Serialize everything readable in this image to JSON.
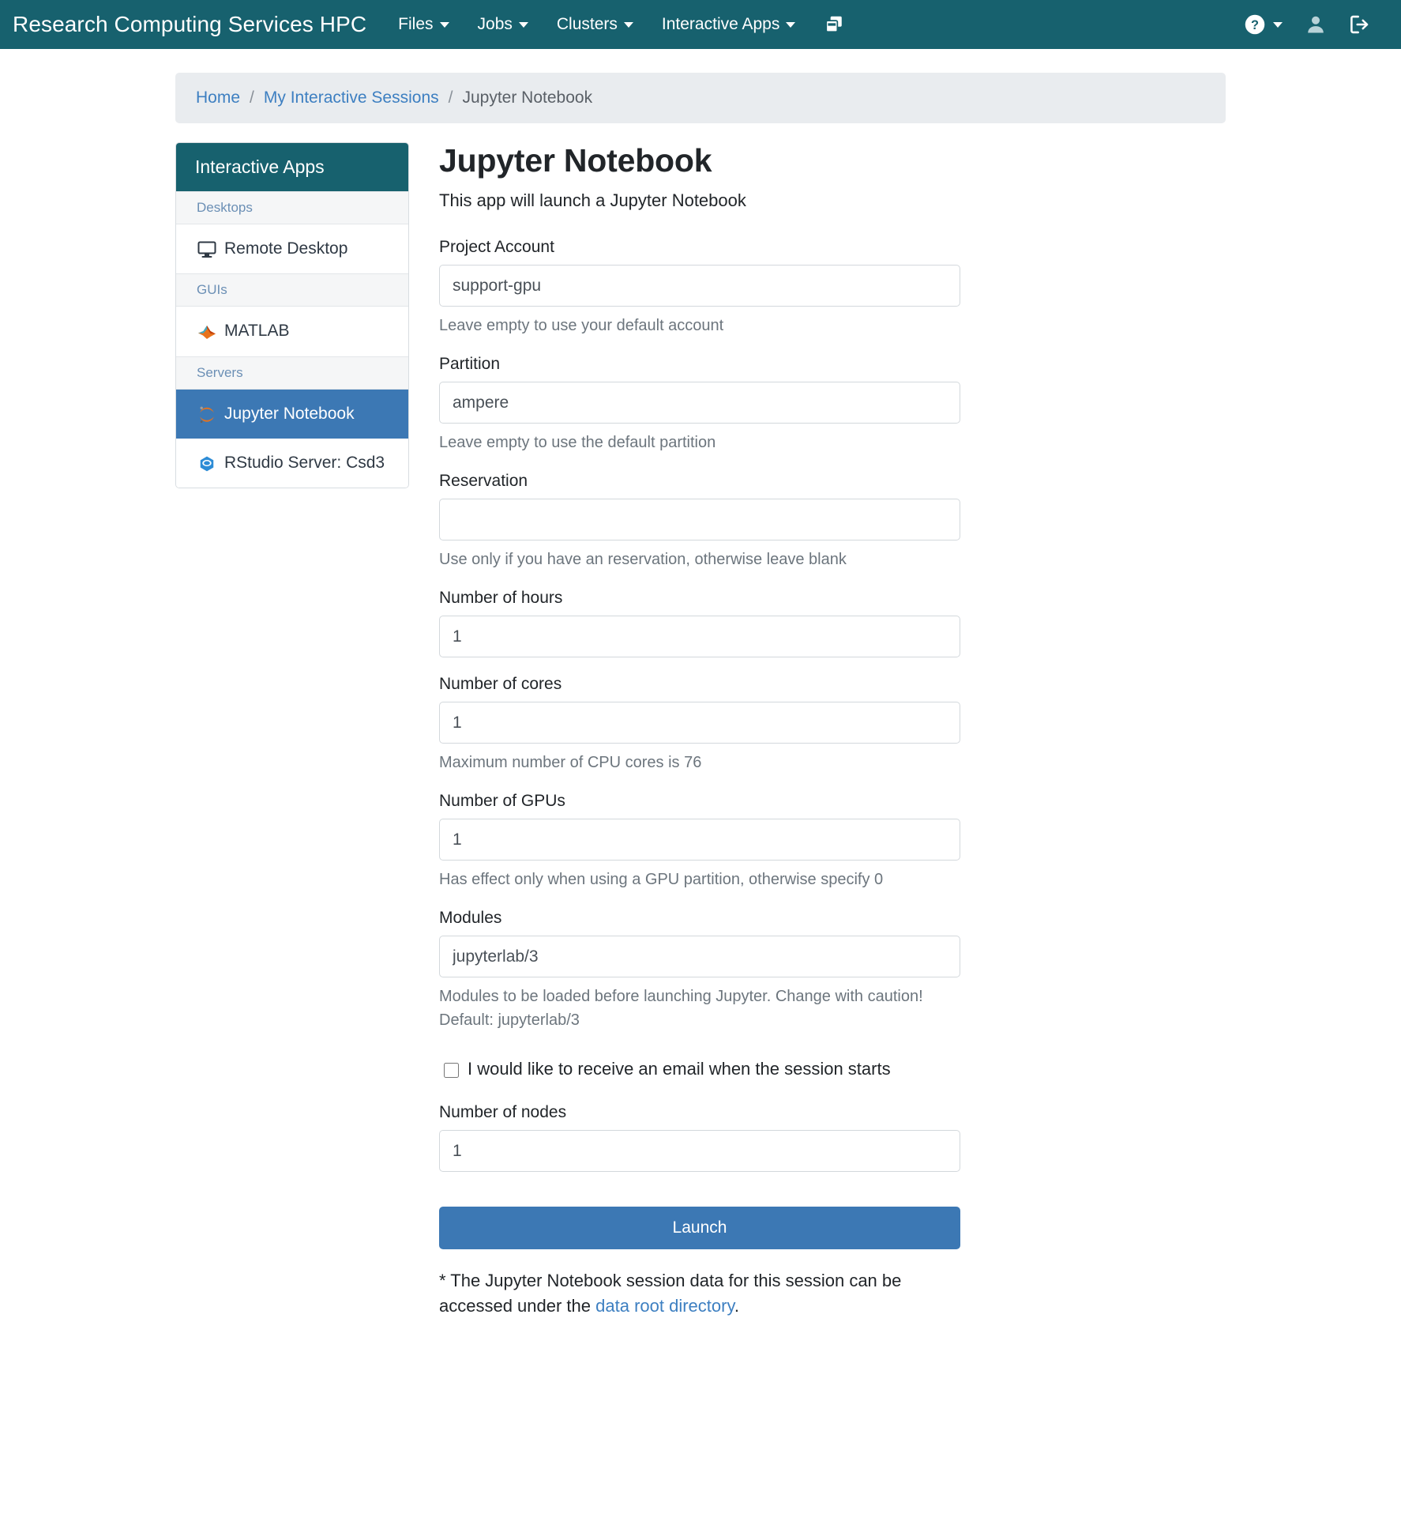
{
  "navbar": {
    "brand": "Research Computing Services HPC",
    "menus": [
      {
        "label": "Files",
        "icon": "chevron-down-icon"
      },
      {
        "label": "Jobs",
        "icon": "chevron-down-icon"
      },
      {
        "label": "Clusters",
        "icon": "chevron-down-icon"
      },
      {
        "label": "Interactive Apps",
        "icon": "chevron-down-icon"
      }
    ],
    "clone_icon": "windows-clone-icon",
    "help_icon": "question-circle-icon",
    "user_icon": "user-icon",
    "logout_icon": "sign-out-icon",
    "background": "#17616e"
  },
  "breadcrumb": {
    "items": [
      {
        "label": "Home",
        "link": true
      },
      {
        "label": "My Interactive Sessions",
        "link": true
      },
      {
        "label": "Jupyter Notebook",
        "link": false
      }
    ],
    "separator": "/"
  },
  "sidebar": {
    "header": "Interactive Apps",
    "groups": [
      {
        "label": "Desktops",
        "items": [
          {
            "label": "Remote Desktop",
            "icon": "desktop-icon",
            "active": false
          }
        ]
      },
      {
        "label": "GUIs",
        "items": [
          {
            "label": "MATLAB",
            "icon": "matlab-icon",
            "active": false
          }
        ]
      },
      {
        "label": "Servers",
        "items": [
          {
            "label": "Jupyter Notebook",
            "icon": "jupyter-icon",
            "active": true
          },
          {
            "label": "RStudio Server: Csd3",
            "icon": "rstudio-icon",
            "active": false
          }
        ]
      }
    ],
    "active_color": "#3c78b4"
  },
  "main": {
    "title": "Jupyter Notebook",
    "lead": "This app will launch a Jupyter Notebook",
    "fields": {
      "project_account": {
        "label": "Project Account",
        "value": "support-gpu",
        "placeholder": "",
        "help": "Leave empty to use your default account"
      },
      "partition": {
        "label": "Partition",
        "value": "ampere",
        "placeholder": "",
        "help": "Leave empty to use the default partition"
      },
      "reservation": {
        "label": "Reservation",
        "value": "",
        "placeholder": "",
        "help": "Use only if you have an reservation, otherwise leave blank"
      },
      "hours": {
        "label": "Number of hours",
        "value": "1",
        "placeholder": "",
        "help": ""
      },
      "cores": {
        "label": "Number of cores",
        "value": "1",
        "placeholder": "",
        "help": "Maximum number of CPU cores is 76"
      },
      "gpus": {
        "label": "Number of GPUs",
        "value": "1",
        "placeholder": "",
        "help": "Has effect only when using a GPU partition, otherwise specify 0"
      },
      "modules": {
        "label": "Modules",
        "value": "jupyterlab/3",
        "placeholder": "",
        "help": "Modules to be loaded before launching Jupyter. Change with caution!",
        "help2": "Default: jupyterlab/3"
      },
      "nodes": {
        "label": "Number of nodes",
        "value": "1",
        "placeholder": "",
        "help": ""
      }
    },
    "email_checkbox": {
      "label": "I would like to receive an email when the session starts",
      "checked": false
    },
    "launch_button": {
      "label": "Launch",
      "color": "#3c78b4"
    },
    "footnote": {
      "before": "* The Jupyter Notebook session data for this session can be accessed under the ",
      "link": "data root directory",
      "after": "."
    }
  }
}
